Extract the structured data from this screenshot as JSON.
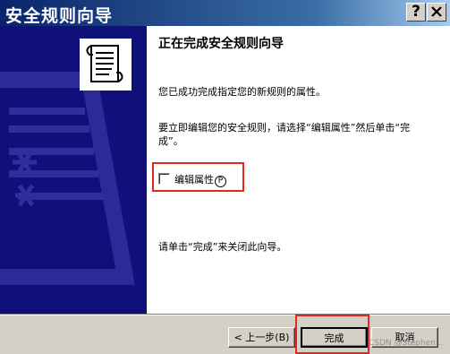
{
  "window": {
    "title": "安全规则向导"
  },
  "titlebar": {
    "help_label": "?",
    "close_label": "X"
  },
  "content": {
    "heading": "正在完成安全规则向导",
    "para1": "您已成功完成指定您的新规则的属性。",
    "para2": "要立即编辑您的安全规则，请选择“编辑属性”然后单击“完成”。",
    "checkbox_label": "编辑属性",
    "checkbox_accel": "P",
    "checkbox_checked": false,
    "para3": "请单击“完成”来关闭此向导。"
  },
  "buttons": {
    "back": "< 上一步(B)",
    "finish": "完成",
    "cancel": "取消"
  },
  "watermark": "CSDN @Stephen..."
}
